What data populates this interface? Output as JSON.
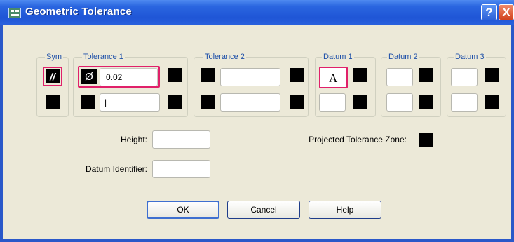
{
  "window": {
    "title": "Geometric Tolerance",
    "help_label": "?",
    "close_label": "X"
  },
  "groups": {
    "sym": "Sym",
    "tolerance1": "Tolerance 1",
    "tolerance2": "Tolerance 2",
    "datum1": "Datum 1",
    "datum2": "Datum 2",
    "datum3": "Datum 3"
  },
  "row1": {
    "sym_symbol": "//",
    "diameter_symbol": "Ø",
    "tolerance1_value": "0.02",
    "datum1_value": "A"
  },
  "row2": {
    "tolerance1_value": "|"
  },
  "fields": {
    "height_label": "Height:",
    "datum_identifier_label": "Datum Identifier:",
    "projected_zone_label": "Projected Tolerance Zone:"
  },
  "buttons": {
    "ok": "OK",
    "cancel": "Cancel",
    "help": "Help"
  },
  "colors": {
    "highlight": "#e0206a",
    "title_bar": "#2a62de"
  }
}
